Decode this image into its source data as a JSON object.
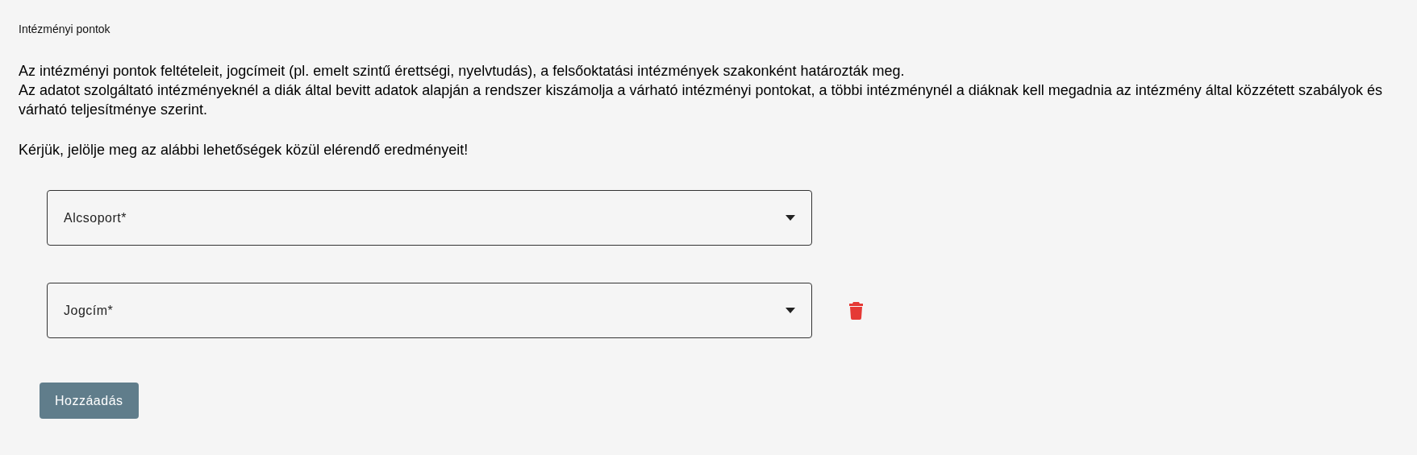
{
  "section_title": "Intézményi pontok",
  "intro": "Az intézményi pontok feltételeit, jogcímeit (pl. emelt szintű érettségi, nyelvtudás), a felsőoktatási intézmények szakonként határozták meg.\nAz adatot szolgáltató intézményeknél a diák által bevitt adatok alapján a rendszer kiszámolja a várható intézményi pontokat, a többi intézménynél a diáknak kell megadnia az intézmény által közzétett szabályok és várható teljesítménye szerint.",
  "instruction": "Kérjük, jelölje meg az alábbi lehetőségek közül elérendő eredményeit!",
  "fields": [
    {
      "label": "Alcsoport*",
      "deletable": false
    },
    {
      "label": "Jogcím*",
      "deletable": true
    }
  ],
  "add_button": "Hozzáadás"
}
